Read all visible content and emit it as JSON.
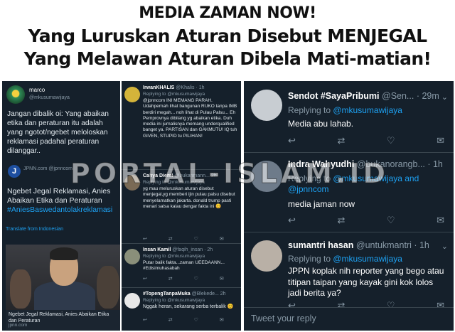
{
  "headline": {
    "line1": "MEDIA ZAMAN NOW!",
    "line2": "Yang Luruskan Aturan Disebut MENJEGAL",
    "line3": "Yang Melawan Aturan Dibela Mati-matian!"
  },
  "watermark": "PORTAL-ISLAM.ID",
  "panel1": {
    "user": "marco",
    "reply_to": "@mkusumawijaya",
    "text": "Jangan dibalik oi: Yang abaikan etika dan peraturan itu adalah yang ngotot/ngebet meloloskan reklamasi padahal peraturan dilanggar..",
    "quote_source": "JPNN.com",
    "quote_handle": "@jpnncom",
    "quote_text": "Ngebet Jegal Reklamasi, Anies Abaikan Etika dan Peraturan",
    "quote_hashtag": "#AniesBaswedantolakreklamasi",
    "translate": "Translate from Indonesian",
    "photo_caption": "Ngebet Jegal Reklamasi, Anies Abaikan Etika dan Peraturan",
    "photo_url": "jpnn.com"
  },
  "panel2": {
    "tweets": [
      {
        "name": "IrwanKHALIS",
        "handle": "@Khalis · 1h",
        "reply": "Replying to @mkusumawijaya",
        "text": "@jpnncom INI MEMANG PARAH. Udahpernah lihat bangunan RUKO tanpa IMB berdiri megah... noh lihat di Pulau Palsu... Eh Pemprovnya dibilang yg abaikan etika. Duh media ini jurnalisnya memang underqualified banget ya. PARTISAN dan GAKMUTU! IQ tuh GIVEN, STUPID tu PILIHAN!"
      },
      {
        "name": "Cahya Diem!",
        "handle": "@bukanmann... 2h",
        "reply": "Replying to @mkusumawijaya",
        "text": "yg mau meluruskan aturan disebut menjegal,yg memberi ijin pulau palsu disebut menyelamatkan jakarta. donald trump pasti menari salsa kalau dengar fakta ini 😊"
      },
      {
        "name": "Insan Kamil",
        "handle": "@faqih_insan · 2h",
        "reply": "Replying to @mkusumawijaya",
        "text": "Putar balik fakta...zaman UEEDAANN... #Edisimuhasabah"
      },
      {
        "name": "#TopengTanpaMuka",
        "handle": "@Blekede... 2h",
        "reply": "Replying to @mkusumawijaya",
        "text": "Nggak heran, sekarang serba terbalik 😊"
      }
    ],
    "actions": "↩ ⇄ ♡ ✉"
  },
  "panel3": {
    "tweets": [
      {
        "name": "Sendot #SayaPribumi",
        "handle": "@Sen... · 29m",
        "reply_prefix": "Replying to ",
        "reply_handle": "@mkusumawijaya",
        "text": "Media abu lahab."
      },
      {
        "name": "Indra Wahyudhi",
        "handle": "@bukanorangb... · 1h",
        "reply_prefix": "Replying to ",
        "reply_handle": "@mkusumawijaya and @jpnncom",
        "text": "media jaman now"
      },
      {
        "name": "sumantri hasan",
        "handle": "@untukmantri · 1h",
        "reply_prefix": "Replying to ",
        "reply_handle": "@mkusumawijaya",
        "text": "JPPN koplak nih reporter yang bego atau titipan taipan yang kayak gini kok lolos jadi berita ya?"
      }
    ],
    "reply_placeholder": "Tweet your reply",
    "icons": [
      "reply-icon",
      "retweet-icon",
      "like-icon",
      "dm-icon"
    ]
  }
}
